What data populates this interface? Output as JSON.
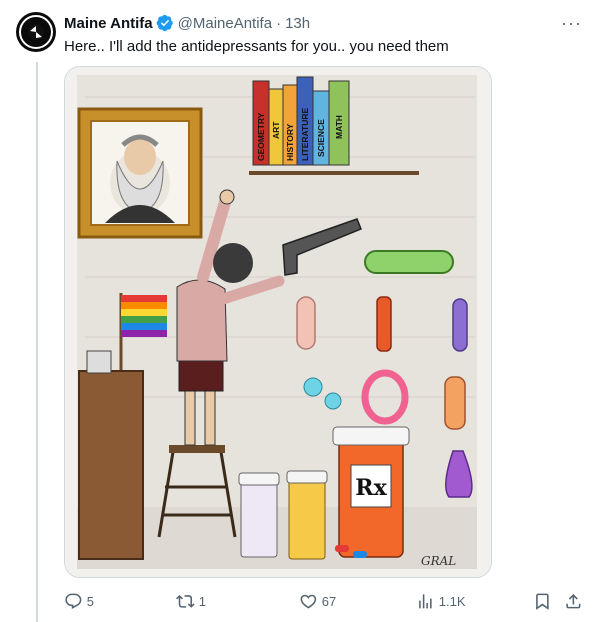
{
  "post": {
    "author_name": "Maine Antifa",
    "handle": "@MaineAntifa",
    "separator": "·",
    "time": "13h",
    "text": "Here.. I'll add the antidepressants for you.. you need them",
    "more_label": "···",
    "verified_icon": "verified-badge-icon",
    "accent_color": "#1d9bf0"
  },
  "media": {
    "book_spines": [
      "GEOMETRY",
      "ART",
      "HISTORY",
      "LITERATURE",
      "SCIENCE",
      "MATH"
    ],
    "rx_label": "Rx",
    "signature": "GRAL"
  },
  "actions": {
    "reply_count": "5",
    "retweet_count": "1",
    "like_count": "67",
    "view_count": "1.1K",
    "icons": [
      "reply-icon",
      "retweet-icon",
      "like-icon",
      "views-icon",
      "bookmark-icon",
      "share-icon"
    ]
  }
}
